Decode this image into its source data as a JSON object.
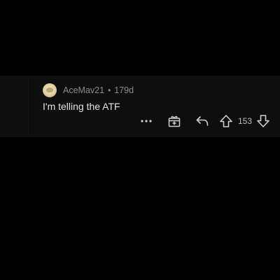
{
  "comment": {
    "username": "AceMav21",
    "separator": "•",
    "age": "179d",
    "body": "I'm telling the ATF",
    "vote_count": "153"
  },
  "icons": {
    "avatar": "user-avatar",
    "more": "more-icon",
    "award": "award-icon",
    "reply": "reply-icon",
    "upvote": "upvote-icon",
    "downvote": "downvote-icon"
  },
  "colors": {
    "background": "#000000",
    "card": "#0e0e0e",
    "meta_text": "#8c8c8c",
    "body_text": "#e3e3e3",
    "icon": "#cfcfcf"
  }
}
